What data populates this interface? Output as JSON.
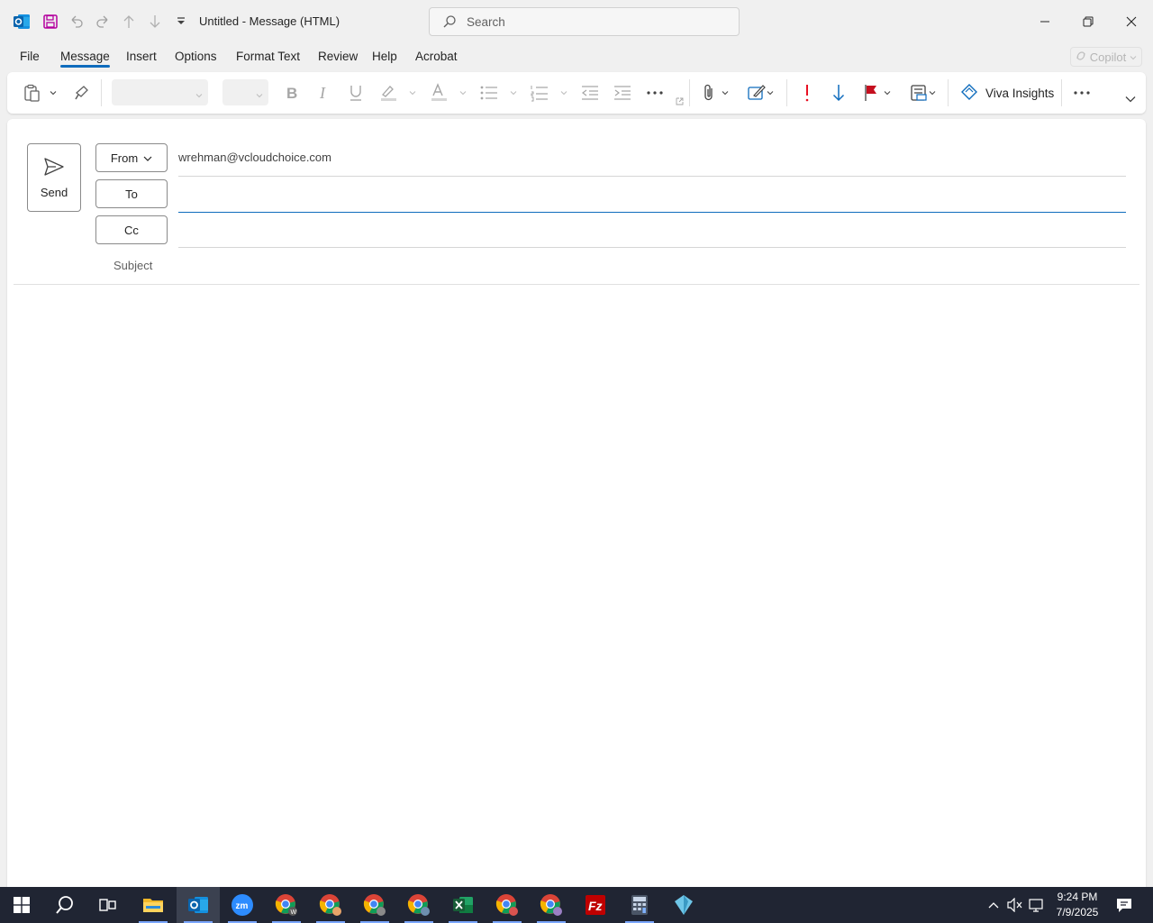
{
  "window": {
    "title": "Untitled  -  Message (HTML)",
    "search_placeholder": "Search"
  },
  "tabs": [
    {
      "label": "File",
      "active": false
    },
    {
      "label": "Message",
      "active": true
    },
    {
      "label": "Insert",
      "active": false
    },
    {
      "label": "Options",
      "active": false
    },
    {
      "label": "Format Text",
      "active": false
    },
    {
      "label": "Review",
      "active": false
    },
    {
      "label": "Help",
      "active": false
    },
    {
      "label": "Acrobat",
      "active": false
    }
  ],
  "copilot_label": "Copilot",
  "ribbon": {
    "font_name": "",
    "font_size": "",
    "viva_insights_label": "Viva Insights",
    "colors": {
      "highlight": "#d6d6d6",
      "font_color": "#d6d6d6",
      "importance_high": "#e81123",
      "importance_low": "#0f6cbd",
      "flag": "#c50f1f"
    }
  },
  "compose": {
    "send_label": "Send",
    "from_label": "From",
    "from_value": "wrehman@vcloudchoice.com",
    "to_label": "To",
    "to_value": "",
    "cc_label": "Cc",
    "cc_value": "",
    "subject_label": "Subject",
    "subject_value": "",
    "body_value": ""
  },
  "taskbar": {
    "apps": [
      "windows-start-icon",
      "search-icon",
      "task-view-icon",
      "file-explorer-icon",
      "outlook-icon",
      "zoom-icon",
      "chrome-icon",
      "chrome-icon",
      "chrome-icon",
      "chrome-icon",
      "excel-icon",
      "chrome-icon",
      "chrome-icon",
      "filezilla-icon",
      "calculator-icon",
      "app-icon"
    ],
    "time": "9:24 PM",
    "date": "7/9/2025"
  }
}
